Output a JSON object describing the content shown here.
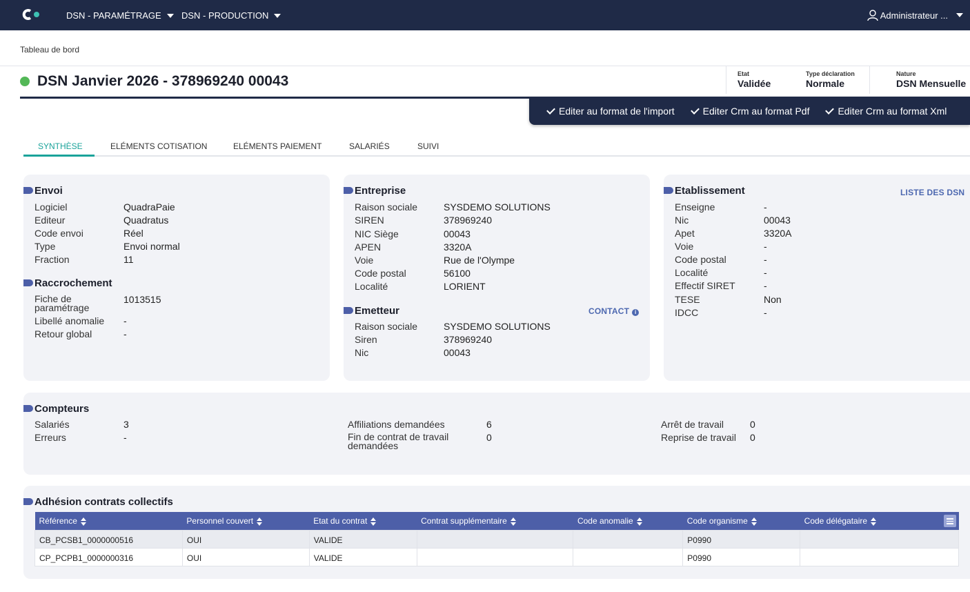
{
  "navbar": {
    "menu1": "DSN - PARAMÉTRAGE",
    "menu2": "DSN - PRODUCTION",
    "user": "Administrateur ..."
  },
  "breadcrumb": "Tableau de bord",
  "header": {
    "title": "DSN Janvier 2026 - 378969240 00043",
    "status_color": "#53b857",
    "meta": [
      {
        "label": "Etat",
        "value": "Validée"
      },
      {
        "label": "Type déclaration",
        "value": "Normale"
      },
      {
        "label": "Nature",
        "value": "DSN Mensuelle"
      }
    ]
  },
  "actions": [
    "Editer au format de l'import",
    "Editer Crm au format Pdf",
    "Editer Crm au format Xml"
  ],
  "tabs": [
    "Synthèse",
    "Eléments cotisation",
    "Eléments paiement",
    "Salariés",
    "Suivi"
  ],
  "envoi": {
    "title": "Envoi",
    "rows": [
      {
        "k": "Logiciel",
        "v": "QuadraPaie"
      },
      {
        "k": "Editeur",
        "v": "Quadratus"
      },
      {
        "k": "Code envoi",
        "v": "Réel"
      },
      {
        "k": "Type",
        "v": "Envoi normal"
      },
      {
        "k": "Fraction",
        "v": "11"
      }
    ]
  },
  "raccrochement": {
    "title": "Raccrochement",
    "rows": [
      {
        "k": "Fiche de paramétrage",
        "v": "1013515"
      },
      {
        "k": "Libellé anomalie",
        "v": "-"
      },
      {
        "k": "Retour global",
        "v": "-"
      }
    ]
  },
  "entreprise": {
    "title": "Entreprise",
    "rows": [
      {
        "k": "Raison sociale",
        "v": "SYSDEMO SOLUTIONS"
      },
      {
        "k": "SIREN",
        "v": "378969240"
      },
      {
        "k": "NIC Siège",
        "v": "00043"
      },
      {
        "k": "APEN",
        "v": "3320A"
      },
      {
        "k": "Voie",
        "v": "Rue de l'Olympe"
      },
      {
        "k": "Code postal",
        "v": "56100"
      },
      {
        "k": "Localité",
        "v": "LORIENT"
      }
    ]
  },
  "emetteur": {
    "title": "Emetteur",
    "contact": "CONTACT",
    "rows": [
      {
        "k": "Raison sociale",
        "v": "SYSDEMO SOLUTIONS"
      },
      {
        "k": "Siren",
        "v": "378969240"
      },
      {
        "k": "Nic",
        "v": "00043"
      }
    ]
  },
  "etablissement": {
    "title": "Etablissement",
    "link": "LISTE DES DSN",
    "rows": [
      {
        "k": "Enseigne",
        "v": "-"
      },
      {
        "k": "Nic",
        "v": "00043"
      },
      {
        "k": "Apet",
        "v": "3320A"
      },
      {
        "k": "Voie",
        "v": "-"
      },
      {
        "k": "Code postal",
        "v": "-"
      },
      {
        "k": "Localité",
        "v": "-"
      },
      {
        "k": "Effectif SIRET",
        "v": "-"
      },
      {
        "k": "TESE",
        "v": "Non"
      },
      {
        "k": "IDCC",
        "v": "-"
      }
    ]
  },
  "compteurs": {
    "title": "Compteurs",
    "col1": [
      {
        "k": "Salariés",
        "v": "3"
      },
      {
        "k": "Erreurs",
        "v": "-"
      }
    ],
    "col2": [
      {
        "k": "Affiliations demandées",
        "v": "6"
      },
      {
        "k": "Fin de contrat de travail demandées",
        "v": "0"
      }
    ],
    "col3": [
      {
        "k": "Arrêt de travail",
        "v": "0"
      },
      {
        "k": "Reprise de travail",
        "v": "0"
      }
    ]
  },
  "adhesion": {
    "title": "Adhésion contrats collectifs",
    "columns": [
      "Référence",
      "Personnel couvert",
      "Etat du contrat",
      "Contrat supplémentaire",
      "Code anomalie",
      "Code organisme",
      "Code délégataire"
    ],
    "rows": [
      [
        "CB_PCSB1_0000000516",
        "OUI",
        "VALIDE",
        "",
        "",
        "P0990",
        ""
      ],
      [
        "CP_PCPB1_0000000316",
        "OUI",
        "VALIDE",
        "",
        "",
        "P0990",
        ""
      ]
    ]
  }
}
